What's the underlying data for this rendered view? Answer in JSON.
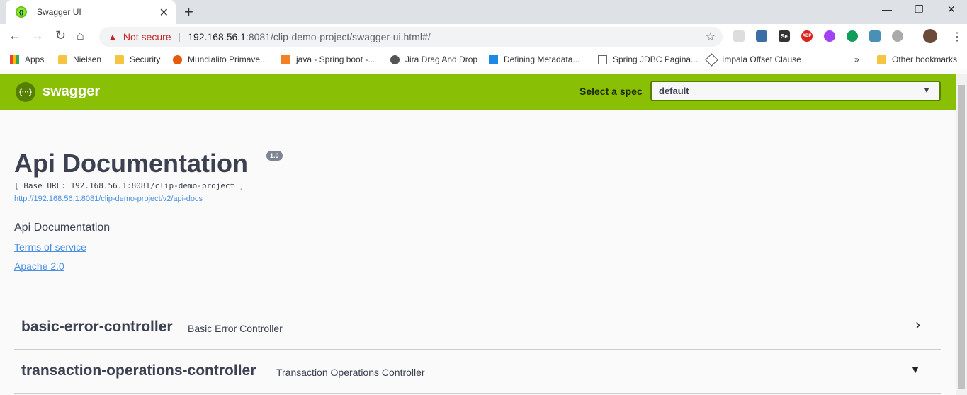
{
  "browser": {
    "tab_title": "Swagger UI",
    "security_label": "Not secure",
    "url_host": "192.168.56.1",
    "url_path": ":8081/clip-demo-project/swagger-ui.html#/",
    "bookmarks": [
      "Apps",
      "Nielsen",
      "Security",
      "Mundialito Primave...",
      "java - Spring boot -...",
      "Jira Drag And Drop",
      "Defining Metadata...",
      "Spring JDBC Pagina...",
      "Impala Offset Clause"
    ],
    "other_bookmarks": "Other bookmarks",
    "ext_se": "Se",
    "ext_abp": "ABP"
  },
  "swagger": {
    "logo_text": "{···}",
    "brand": "swagger",
    "select_label": "Select a spec",
    "selected_spec": "default"
  },
  "info": {
    "title": "Api Documentation",
    "version": "1.0",
    "base_url": "[ Base URL: 192.168.56.1:8081/clip-demo-project ]",
    "api_docs_url": "http://192.168.56.1:8081/clip-demo-project/v2/api-docs",
    "description": "Api Documentation",
    "terms": "Terms of service",
    "license": "Apache 2.0"
  },
  "controllers": [
    {
      "name": "basic-error-controller",
      "description": "Basic Error Controller",
      "expanded": false
    },
    {
      "name": "transaction-operations-controller",
      "description": "Transaction Operations Controller",
      "expanded": true
    }
  ],
  "colors": {
    "accent": "#89bf04",
    "link": "#4990e2",
    "text": "#3b4151"
  }
}
